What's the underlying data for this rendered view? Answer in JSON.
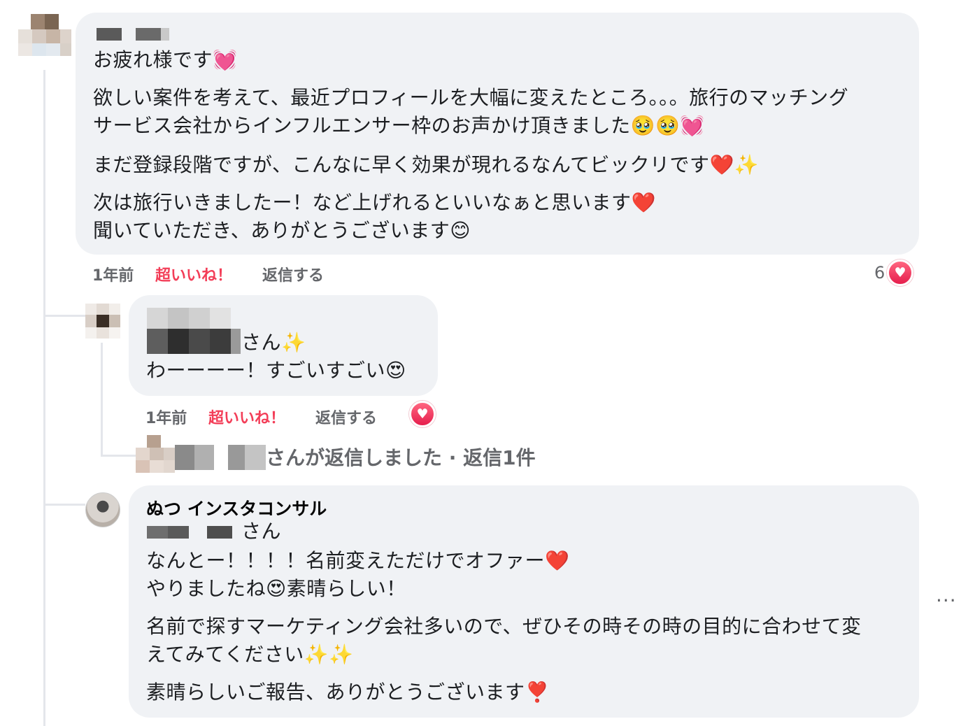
{
  "comment1": {
    "lines": [
      "お疲れ様です💓",
      "欲しい案件を考えて、最近プロフィールを大幅に変えたところ。。。旅行のマッチング",
      "サービス会社からインフルエンサー枠のお声かけ頂きました🥹🥹💓",
      "まだ登録段階ですが、こんなに早く効果が現れるなんてビックリです❤️✨",
      "次は旅行いきましたー！など上げれるといいなぁと思います❤️",
      "聞いていただき、ありがとうございます😊"
    ],
    "time": "1年前",
    "reaction_label": "超いいね！",
    "reply_label": "返信する",
    "reaction_count": "6"
  },
  "comment2": {
    "lines": [
      "さん✨",
      "わーーーー！すごいすごい😍"
    ],
    "time": "1年前",
    "reaction_label": "超いいね！",
    "reply_label": "返信する"
  },
  "replies_summary": "さんが返信しました · 返信1件",
  "comment3": {
    "author": "ぬつ インスタコンサル",
    "lines": [
      "さん",
      "なんとー！！！！名前変えただけでオファー❤️",
      "やりましたね😍素晴らしい！",
      "名前で探すマーケティング会社多いので、ぜひその時その時の目的に合わせて変",
      "えてみてください✨✨",
      "素晴らしいご報告、ありがとうございます❣️"
    ]
  },
  "icons": {
    "heart": "♥",
    "more": "···"
  },
  "colors": {
    "bubble": "#f0f2f5",
    "love": "#f33e58",
    "meta": "#65676b"
  }
}
